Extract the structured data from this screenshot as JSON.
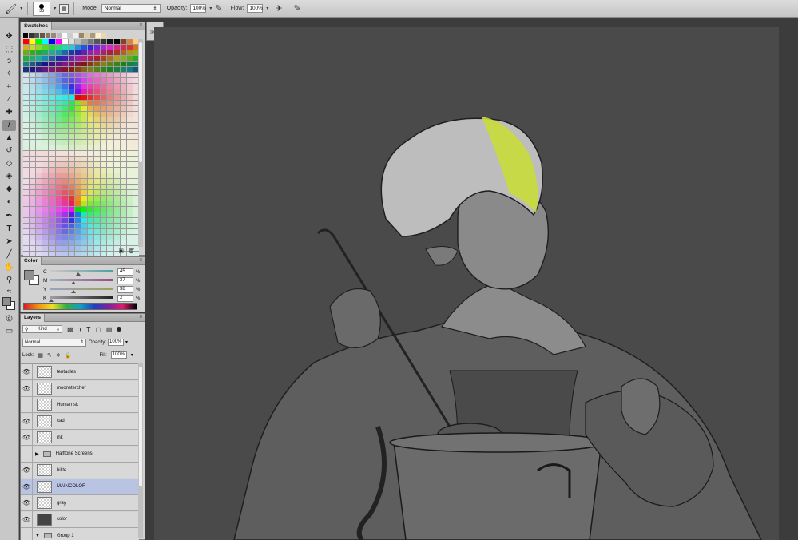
{
  "options_bar": {
    "brush_size": "35",
    "mode_label": "Mode:",
    "mode_value": "Normal",
    "opacity_label": "Opacity:",
    "opacity_value": "100%",
    "flow_label": "Flow:",
    "flow_value": "100%"
  },
  "swatches_panel": {
    "tab_label": "Swatches"
  },
  "color_panel": {
    "tab_label": "Color",
    "channels": [
      {
        "label": "C",
        "value": "45",
        "unit": "%",
        "level": 0.45
      },
      {
        "label": "M",
        "value": "37",
        "unit": "%",
        "level": 0.37
      },
      {
        "label": "Y",
        "value": "38",
        "unit": "%",
        "level": 0.38
      },
      {
        "label": "K",
        "value": "2",
        "unit": "%",
        "level": 0.02
      }
    ]
  },
  "layers_panel": {
    "tab_label": "Layers",
    "filter_kind": "Kind",
    "blend_mode": "Normal",
    "opacity_label": "Opacity:",
    "opacity_value": "100%",
    "lock_label": "Lock:",
    "fill_label": "Fill:",
    "fill_value": "100%",
    "layers": [
      {
        "name": "tentacles",
        "visible": true
      },
      {
        "name": "moonsterchef",
        "visible": true
      },
      {
        "name": "Human sk",
        "visible": false
      },
      {
        "name": "cad",
        "visible": true
      },
      {
        "name": "ink",
        "visible": true
      },
      {
        "name": "Halftone Screens",
        "visible": false
      },
      {
        "name": "hilite",
        "visible": true
      },
      {
        "name": "MAINCOLOR",
        "visible": true
      },
      {
        "name": "gray",
        "visible": true
      },
      {
        "name": "color",
        "visible": true
      },
      {
        "name": "Group 1",
        "visible": false
      }
    ]
  },
  "colors": {
    "foreground": "#8f8f8f",
    "background": "#ffffff",
    "canvas_bg": "#4a4a4a",
    "hat_highlight": "#c8dc3a",
    "layer_selected": "#b8c4e2"
  },
  "icons": [
    "brush-icon",
    "move-icon",
    "marquee-icon",
    "lasso-icon",
    "quick-select-icon",
    "crop-icon",
    "eyedropper-icon",
    "healing-icon",
    "brush-tool-icon",
    "stamp-icon",
    "history-brush-icon",
    "eraser-icon",
    "bucket-icon",
    "blur-icon",
    "dodge-icon",
    "pen-icon",
    "type-icon",
    "path-select-icon",
    "line-icon",
    "hand-icon",
    "zoom-icon",
    "eye-icon",
    "folder-icon",
    "chain-icon",
    "trash-icon"
  ]
}
